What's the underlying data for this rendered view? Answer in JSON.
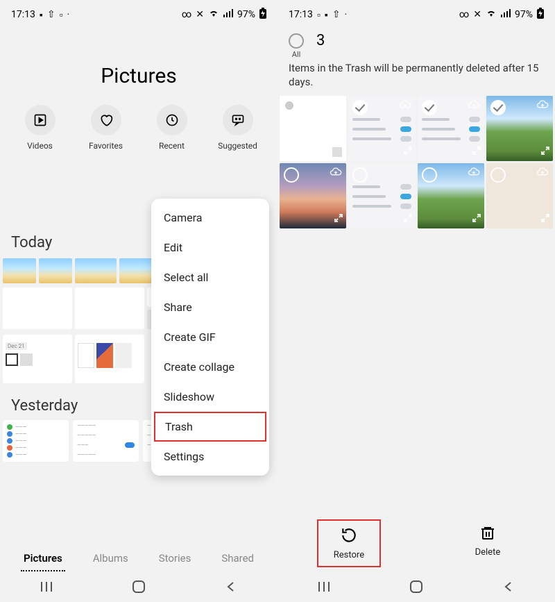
{
  "status": {
    "time": "17:13",
    "battery": "97%"
  },
  "left": {
    "title": "Pictures",
    "quick": [
      {
        "label": "Videos"
      },
      {
        "label": "Favorites"
      },
      {
        "label": "Recent"
      },
      {
        "label": "Suggested"
      }
    ],
    "sections": {
      "today": "Today",
      "yesterday": "Yesterday"
    },
    "menu": [
      "Camera",
      "Edit",
      "Select all",
      "Share",
      "Create GIF",
      "Create collage",
      "Slideshow",
      "Trash",
      "Settings"
    ],
    "highlight_index": 7,
    "tabs": [
      {
        "label": "Pictures",
        "active": true
      },
      {
        "label": "Albums",
        "active": false
      },
      {
        "label": "Stories",
        "active": false
      },
      {
        "label": "Shared",
        "active": false
      }
    ]
  },
  "right": {
    "select_all_label": "All",
    "selected_count": "3",
    "message": "Items in the Trash will be permanently deleted after 15 days.",
    "grid": [
      {
        "style": "feed",
        "selected": false,
        "cloud": false
      },
      {
        "style": "settings",
        "selected": true,
        "cloud": true
      },
      {
        "style": "settings",
        "selected": true,
        "cloud": true
      },
      {
        "style": "landscape-green",
        "selected": true,
        "cloud": true
      },
      {
        "style": "sunset",
        "selected": false,
        "cloud": true
      },
      {
        "style": "settings",
        "selected": false,
        "cloud": false
      },
      {
        "style": "landscape-green",
        "selected": false,
        "cloud": true
      },
      {
        "style": "blank",
        "selected": false,
        "cloud": true
      }
    ],
    "actions": {
      "restore": "Restore",
      "delete": "Delete"
    }
  }
}
